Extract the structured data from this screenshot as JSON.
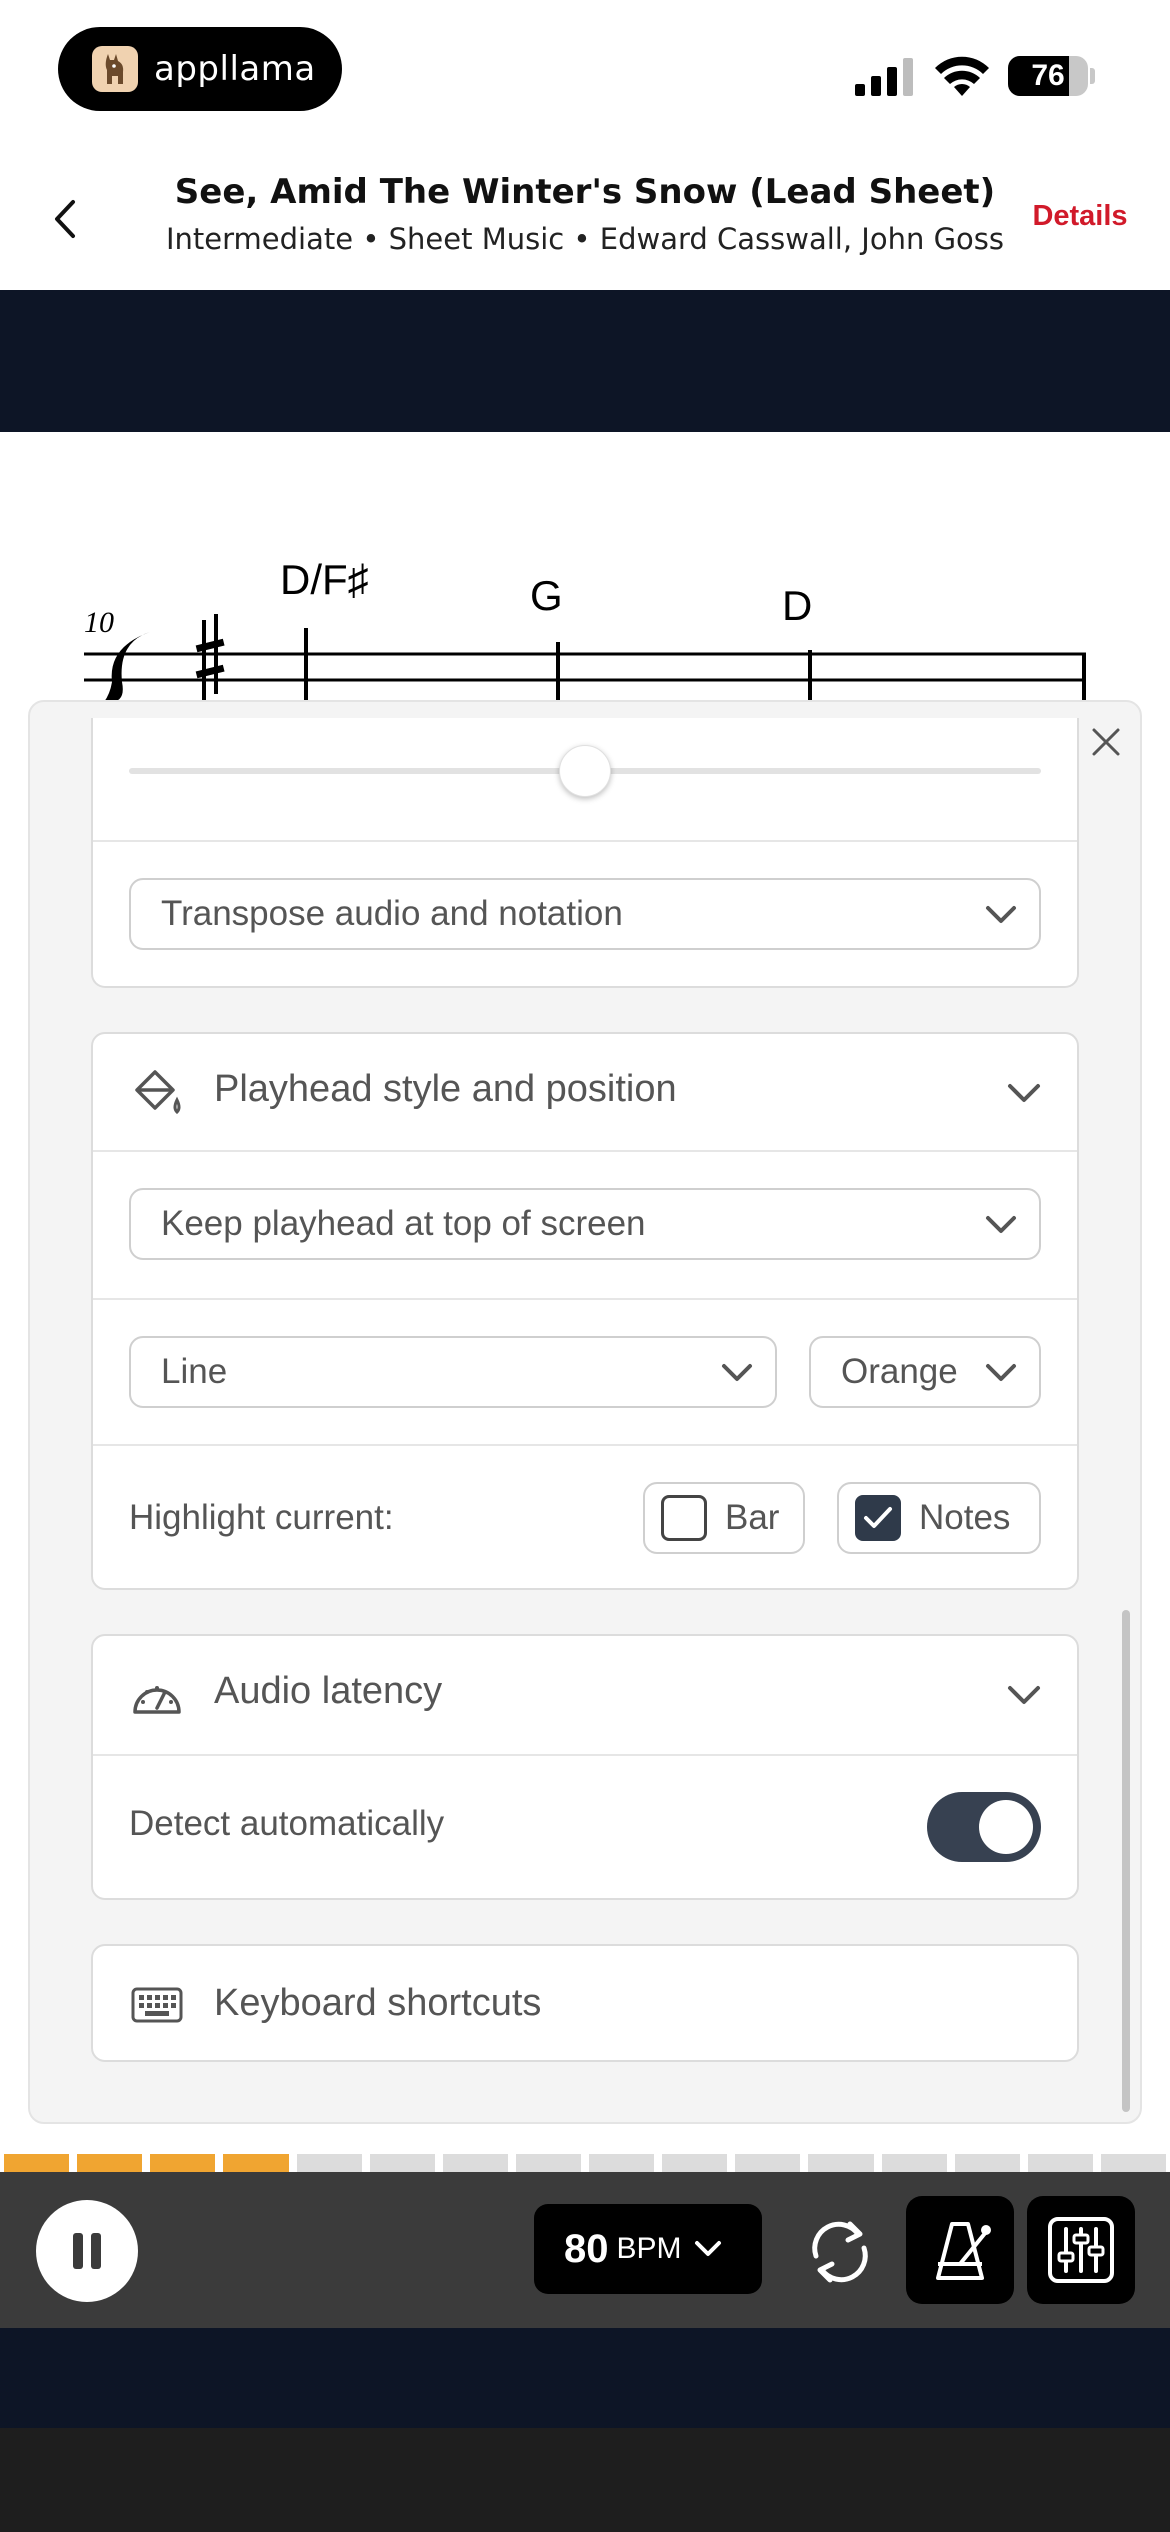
{
  "status_bar": {
    "app_name": "appllama",
    "battery_level": "76",
    "battery_fraction": 0.76
  },
  "header": {
    "title": "See, Amid The Winter's Snow (Lead Sheet)",
    "subtitle": "Intermediate  •  Sheet Music  •  Edward Casswall, John Goss",
    "details_label": "Details"
  },
  "score": {
    "measure_number": "10",
    "chords": [
      "D/F♯",
      "G",
      "D"
    ]
  },
  "transpose": {
    "slider_fraction": 0.5,
    "mode_select": "Transpose audio and notation"
  },
  "playhead": {
    "title": "Playhead style and position",
    "position_select": "Keep playhead at top of screen",
    "style_select": "Line",
    "color_select": "Orange",
    "highlight_label": "Highlight current:",
    "bar_label": "Bar",
    "bar_checked": false,
    "notes_label": "Notes",
    "notes_checked": true
  },
  "audio_latency": {
    "title": "Audio latency",
    "detect_label": "Detect automatically",
    "detect_on": true
  },
  "keyboard": {
    "title": "Keyboard shortcuts"
  },
  "progress": {
    "filled_segments": 4,
    "total_segments": 16,
    "played_color": "#f0a531",
    "unplayed_color": "#dcdcdc"
  },
  "player": {
    "bpm_value": "80",
    "bpm_unit": "BPM"
  },
  "colors": {
    "accent_red": "#d11a2a",
    "dark_navy": "#0d1526",
    "player_bg": "#3b3b3b",
    "toggle_on": "#374151"
  }
}
